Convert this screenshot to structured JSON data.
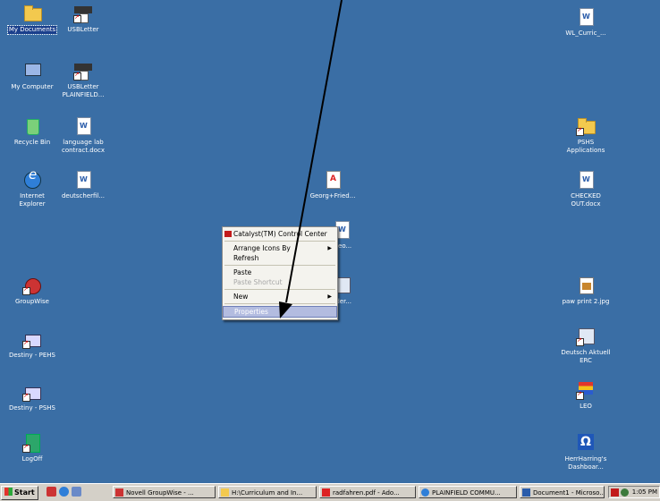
{
  "desktop": {
    "icons": [
      {
        "label": "My Documents",
        "icon": "folder-icon",
        "selected": true
      },
      {
        "label": "USBLetter",
        "icon": "usb-shortcut-icon"
      },
      {
        "label": "My Computer",
        "icon": "computer-icon"
      },
      {
        "label": "USBLetter\nPLAINFIELD...",
        "icon": "usb-shortcut-icon"
      },
      {
        "label": "Recycle Bin",
        "icon": "recycle-bin-icon"
      },
      {
        "label": "language lab\ncontract.docx",
        "icon": "word-document-icon"
      },
      {
        "label": "Internet\nExplorer",
        "icon": "internet-explorer-icon"
      },
      {
        "label": "deutscherfil...",
        "icon": "word-document-icon"
      },
      {
        "label": "Georg+Fried...",
        "icon": "pdf-document-icon"
      },
      {
        "label": "nteo...",
        "icon": "word-document-icon"
      },
      {
        "label": "eder...",
        "icon": "document-icon"
      },
      {
        "label": "GroupWise",
        "icon": "groupwise-icon"
      },
      {
        "label": "Destiny - PEHS",
        "icon": "house-shortcut-icon"
      },
      {
        "label": "Destiny - PSHS",
        "icon": "house-shortcut-icon"
      },
      {
        "label": "LogOff",
        "icon": "logoff-icon"
      },
      {
        "label": "WL_Curric_...",
        "icon": "word-document-icon"
      },
      {
        "label": "PSHS\nApplications",
        "icon": "folder-shortcut-icon"
      },
      {
        "label": "CHECKED\nOUT.docx",
        "icon": "word-document-icon"
      },
      {
        "label": "paw print 2.jpg",
        "icon": "image-file-icon"
      },
      {
        "label": "Deutsch Aktuell\nERC",
        "icon": "document-shortcut-icon"
      },
      {
        "label": "LEO",
        "icon": "leo-shortcut-icon"
      },
      {
        "label": "HerrHarring's\nDashboar...",
        "icon": "dashboard-icon"
      }
    ]
  },
  "context_menu": {
    "header": "Catalyst(TM) Control Center",
    "arrange_icons": "Arrange Icons By",
    "refresh": "Refresh",
    "paste": "Paste",
    "paste_shortcut": "Paste Shortcut",
    "new": "New",
    "properties": "Properties"
  },
  "taskbar": {
    "start_label": "Start",
    "buttons": [
      "Novell GroupWise - ...",
      "H:\\Curriculum and In...",
      "radfahren.pdf - Ado...",
      "PLAINFIELD COMMU...",
      "Document1 - Microso..."
    ],
    "clock": "1:05 PM"
  },
  "colors": {
    "desktop": "#3a6ea5",
    "taskbar": "#d4d0c8",
    "menu_highlight": "#b3bce0"
  }
}
